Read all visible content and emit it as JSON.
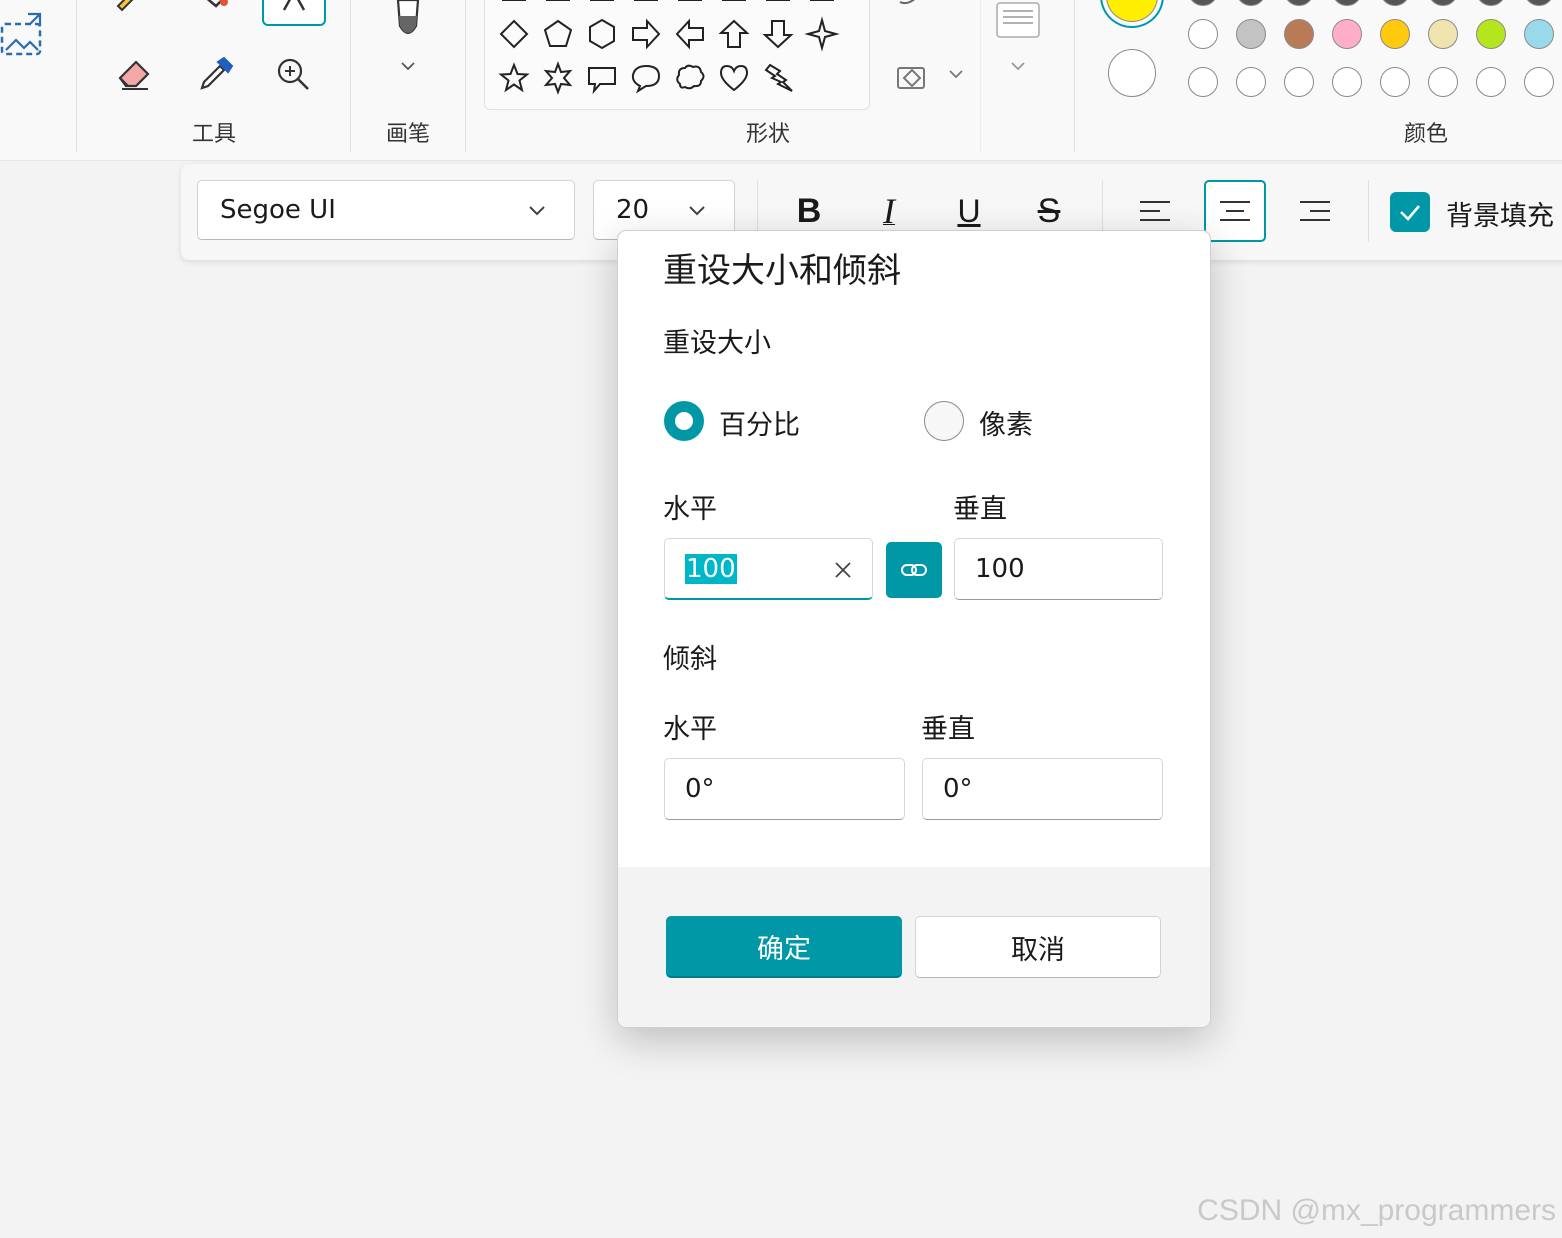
{
  "ribbon": {
    "groups": {
      "tools": "工具",
      "brushes": "画笔",
      "shapes": "形状",
      "colors": "颜色"
    },
    "tool_icons": [
      "pencil-icon",
      "fill-icon",
      "text-icon",
      "eraser-icon",
      "color-picker-icon",
      "magnifier-icon"
    ],
    "shape_icons": [
      "diamond",
      "pentagon",
      "hexagon",
      "arrow-right",
      "arrow-left",
      "arrow-up",
      "arrow-down",
      "four-point-star",
      "five-point-star",
      "six-point-star",
      "callout-rect",
      "callout-oval",
      "callout-cloud",
      "heart",
      "lightning"
    ],
    "colors": {
      "color1": "#ffee00",
      "color2": "#ffffff",
      "palette_row": [
        "#ffffff",
        "#c3c3c3",
        "#b97a57",
        "#ffaec9",
        "#ffc90e",
        "#efe4b0",
        "#b5e61d",
        "#99d9ea"
      ],
      "custom_row_count": 8
    }
  },
  "textbar": {
    "font_family": "Segoe UI",
    "font_size": "20",
    "bold": "B",
    "italic": "I",
    "underline": "U",
    "strikethrough": "S",
    "alignment": "center",
    "background_fill": {
      "label": "背景填充",
      "checked": true
    }
  },
  "dialog": {
    "title": "重设大小和倾斜",
    "resize_section": "重设大小",
    "mode_options": [
      {
        "label": "百分比",
        "selected": true
      },
      {
        "label": "像素",
        "selected": false
      }
    ],
    "horizontal_label": "水平",
    "vertical_label": "垂直",
    "resize_horizontal_value": "100",
    "resize_vertical_value": "100",
    "aspect_locked": true,
    "skew_section": "倾斜",
    "skew_horizontal_label": "水平",
    "skew_vertical_label": "垂直",
    "skew_horizontal_value": "0°",
    "skew_vertical_value": "0°",
    "ok_label": "确定",
    "cancel_label": "取消"
  },
  "accent_color": "#0097a7",
  "watermark": "CSDN @mx_programmers"
}
